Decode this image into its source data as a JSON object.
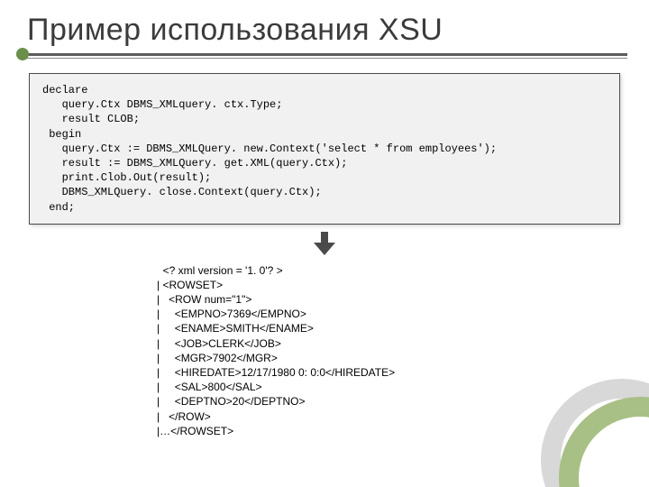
{
  "title": "Пример использования XSU",
  "code": "declare\n   query.Ctx DBMS_XMLquery. ctx.Type;\n   result CLOB;\n begin\n   query.Ctx := DBMS_XMLQuery. new.Context('select * from employees');\n   result := DBMS_XMLQuery. get.XML(query.Ctx);\n   print.Clob.Out(result);\n   DBMS_XMLQuery. close.Context(query.Ctx);\n end;",
  "xml": "  <? xml version = '1. 0'? >\n| <ROWSET>\n|   <ROW num=\"1\">\n|     <EMPNO>7369</EMPNO>\n|     <ENAME>SMITH</ENAME>\n|     <JOB>CLERK</JOB>\n|     <MGR>7902</MGR>\n|     <HIREDATE>12/17/1980 0: 0:0</HIREDATE>\n|     <SAL>800</SAL>\n|     <DEPTNO>20</DEPTNO>\n|   </ROW>\n|…</ROWSET>"
}
